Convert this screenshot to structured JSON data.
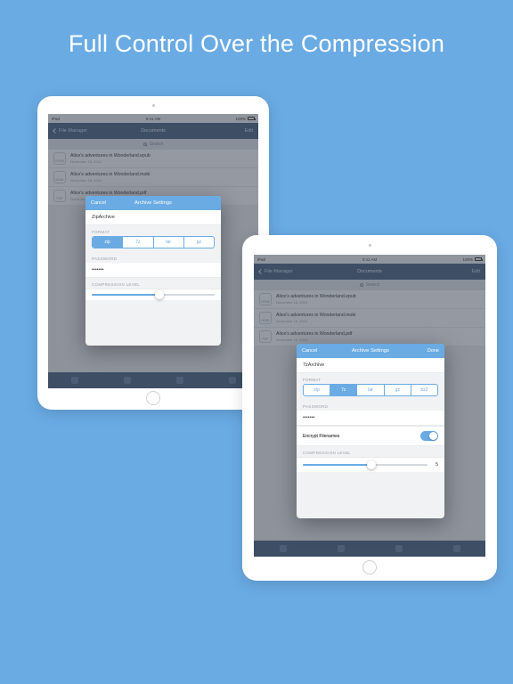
{
  "headline": "Full Control Over the Compression",
  "status": {
    "carrier": "iPad",
    "time": "9:41 AM",
    "battery": "100%"
  },
  "nav": {
    "back": "File Manager",
    "title": "Documents",
    "edit": "Edit"
  },
  "search": {
    "placeholder": "Search"
  },
  "files": [
    {
      "name": "Alice's adventures in Wonderland.epub",
      "date": "November 16, 2015",
      "ext": "EPUB"
    },
    {
      "name": "Alice's adventures in Wonderland.mobi",
      "date": "November 16, 2015",
      "ext": "MOBI"
    },
    {
      "name": "Alice's adventures in Wonderland.pdf",
      "date": "November 16, 2015",
      "ext": "PDF"
    }
  ],
  "modal": {
    "cancel": "Cancel",
    "done": "Done",
    "title": "Archive Settings",
    "format_label": "FORMAT",
    "password_label": "PASSWORD",
    "compression_label": "COMPRESSION LEVEL",
    "encrypt_label": "Encrypt Filenames"
  },
  "left": {
    "archive_name": "ZipArchive",
    "formats": [
      "zip",
      "7z",
      "tar",
      "gz"
    ],
    "selected_format": "zip",
    "password_mask": "•••••••",
    "compression_value": "5"
  },
  "right": {
    "archive_name": "7zArchive",
    "formats": [
      "zip",
      "7z",
      "tar",
      "gz",
      "bz2"
    ],
    "selected_format": "7z",
    "password_mask": "•••••••",
    "encrypt_on": true,
    "compression_value": "5"
  }
}
